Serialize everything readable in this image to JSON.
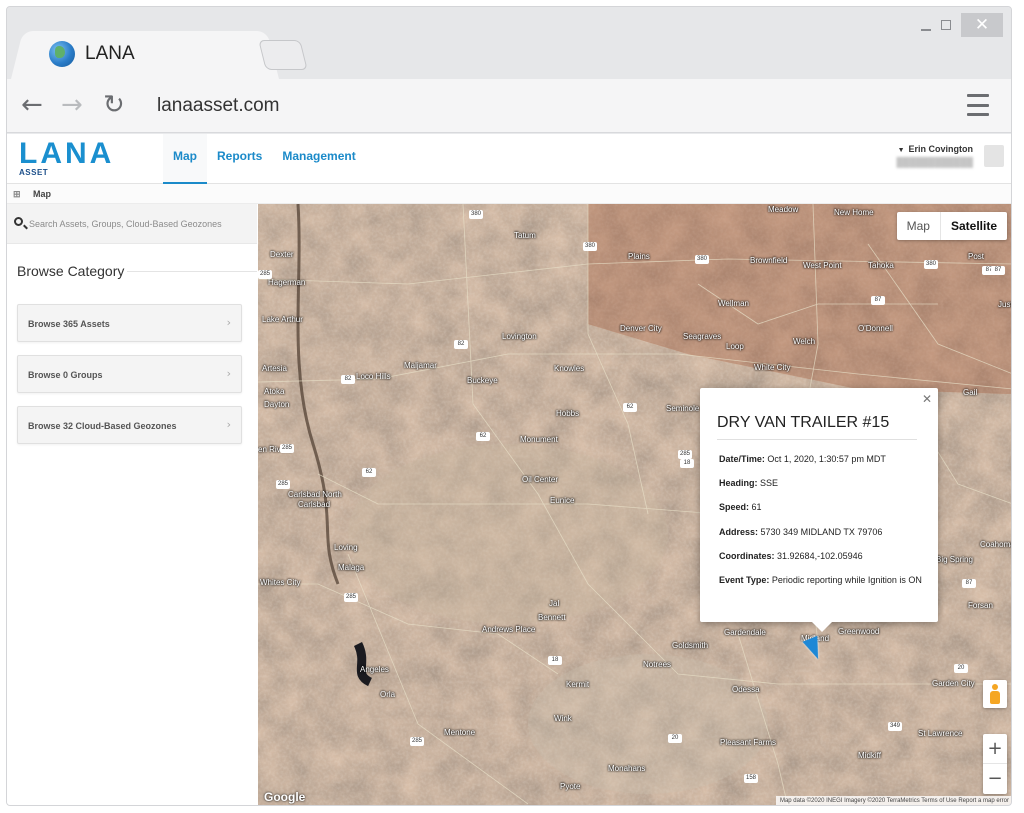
{
  "browser": {
    "tab_title": "LANA",
    "url": "lanaasset.com",
    "window_close_glyph": "✕"
  },
  "app": {
    "logo_main": "LANA",
    "logo_sub": "ASSET",
    "tabs": [
      {
        "label": "Map",
        "active": true
      },
      {
        "label": "Reports",
        "active": false
      },
      {
        "label": "Management",
        "active": false
      }
    ],
    "user": {
      "name": "Erin Covington"
    },
    "breadcrumb": "Map"
  },
  "sidebar": {
    "search_placeholder": "Search Assets, Groups, Cloud-Based Geozones",
    "browse_title": "Browse Category",
    "items": [
      {
        "label": "Browse 365 Assets"
      },
      {
        "label": "Browse 0 Groups"
      },
      {
        "label": "Browse 32 Cloud-Based Geozones"
      }
    ]
  },
  "map": {
    "type_map": "Map",
    "type_satellite": "Satellite",
    "google": "Google",
    "attribution": "Map data ©2020 INEGI Imagery ©2020 TerraMetrics   Terms of Use   Report a map error",
    "places": [
      "Meadow",
      "New Home",
      "Tatum",
      "Dexter",
      "Plains",
      "Brownfield",
      "West Point",
      "Tahoka",
      "Post",
      "Hagerman",
      "Wellman",
      "Just",
      "Lake Arthur",
      "Lovington",
      "Denver City",
      "Seagraves",
      "O'Donnell",
      "Loop",
      "Welch",
      "Maljamar",
      "Loco Hills",
      "Artesia",
      "Knowles",
      "White City",
      "Atoka",
      "Buckeye",
      "Dayton",
      "Gail",
      "Hobbs",
      "Seminole",
      "en Rivers",
      "Monument",
      "Carlsbad North",
      "Carlsbad",
      "Oil Center",
      "Eunice",
      "Loving",
      "Coahoma",
      "Malaga",
      "Big Spring",
      "Whites City",
      "Forsan",
      "Jal",
      "Bennett",
      "Andrews Place",
      "Gardendale",
      "Greenwood",
      "Goldsmith",
      "Midland",
      "Notrees",
      "Angeles",
      "Kermit",
      "Odessa",
      "Garden City",
      "Orla",
      "Wink",
      "Mentone",
      "St Lawrence",
      "Pleasant Farms",
      "Midkiff",
      "Monahans",
      "Pyote"
    ],
    "shields": [
      "380",
      "380",
      "380",
      "380",
      "285",
      "82",
      "82",
      "87",
      "87",
      "62",
      "62",
      "62",
      "285",
      "285",
      "285",
      "285",
      "18",
      "18",
      "20",
      "20",
      "285",
      "349",
      "158",
      "87",
      "87"
    ],
    "zoom_in": "+",
    "zoom_out": "−"
  },
  "popup": {
    "title": "DRY VAN TRAILER #15",
    "rows": [
      {
        "label": "Date/Time:",
        "value": "Oct 1, 2020, 1:30:57 pm MDT"
      },
      {
        "label": "Heading:",
        "value": "SSE"
      },
      {
        "label": "Speed:",
        "value": "61"
      },
      {
        "label": "Address:",
        "value": "5730 349 MIDLAND TX 79706"
      },
      {
        "label": "Coordinates:",
        "value": "31.92684,-102.05946"
      },
      {
        "label": "Event Type:",
        "value": "Periodic reporting while Ignition is ON"
      }
    ]
  }
}
